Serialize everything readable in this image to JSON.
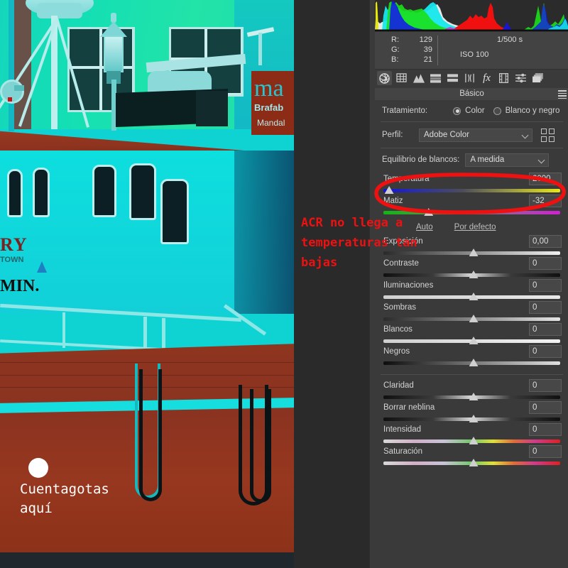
{
  "app": {
    "panel_title": "Básico",
    "hamburger_icon": "hamburger-menu-icon"
  },
  "histogram": {
    "readout": {
      "r_label": "R:",
      "r_value": "129",
      "g_label": "G:",
      "g_value": "39",
      "b_label": "B:",
      "b_value": "21"
    },
    "shutter": "1/500 s",
    "iso": "ISO 100"
  },
  "toolbar": {
    "icons": [
      "basic-aperture-icon",
      "detail-grid-icon",
      "tone-curve-icon",
      "split-toning-icon",
      "graduated-filter-icon",
      "lens-corrections-icon",
      "effects-fx-icon",
      "calibration-film-icon",
      "presets-sliders-icon",
      "snapshots-layers-icon"
    ],
    "active_index": 0
  },
  "treatment": {
    "label": "Tratamiento:",
    "options": [
      "Color",
      "Blanco y negro"
    ],
    "selected": "Color"
  },
  "profile": {
    "label": "Perfil:",
    "value": "Adobe Color",
    "browser_icon": "profile-grid-icon"
  },
  "white_balance": {
    "label": "Equilibrio de blancos:",
    "value": "A medida"
  },
  "auto_links": {
    "auto": "Auto",
    "default": "Por defecto"
  },
  "sliders_wb": [
    {
      "name": "Temperatura",
      "value": "2000",
      "pos": 3,
      "track": "tr-temp"
    },
    {
      "name": "Matiz",
      "value": "-32",
      "pos": 25,
      "track": "tr-tint"
    }
  ],
  "sliders_tone": [
    {
      "name": "Exposición",
      "value": "0,00",
      "pos": 50,
      "track": "tr-grey"
    },
    {
      "name": "Contraste",
      "value": "0",
      "pos": 50,
      "track": "tr-black"
    },
    {
      "name": "Iluminaciones",
      "value": "0",
      "pos": 50,
      "track": "tr-hi"
    },
    {
      "name": "Sombras",
      "value": "0",
      "pos": 50,
      "track": "tr-sh"
    },
    {
      "name": "Blancos",
      "value": "0",
      "pos": 50,
      "track": "tr-wh"
    },
    {
      "name": "Negros",
      "value": "0",
      "pos": 50,
      "track": "tr-bk"
    }
  ],
  "sliders_presence": [
    {
      "name": "Claridad",
      "value": "0",
      "pos": 50,
      "track": "tr-black"
    },
    {
      "name": "Borrar neblina",
      "value": "0",
      "pos": 50,
      "track": "tr-black"
    },
    {
      "name": "Intensidad",
      "value": "0",
      "pos": 50,
      "track": "tr-rainbow"
    },
    {
      "name": "Saturación",
      "value": "0",
      "pos": 50,
      "track": "tr-rainbow"
    }
  ],
  "annotations": {
    "acr_note": "ACR no llega a\ntemperaturas tan\nbajas",
    "acr_note_color": "#ee1111",
    "dropper_note": "Cuentagotas\naquí",
    "dropper_note_color": "#ffffff",
    "highlight_color": "#ee1111"
  },
  "photo": {
    "description": "boat-photo-cyan-cast",
    "banner_text_1": "ma",
    "banner_text_2": "Brafab",
    "banner_text_3": "Mandal",
    "hull_text_1": "RY",
    "hull_text_2": "TOWN",
    "hull_text_3": "MIN."
  }
}
